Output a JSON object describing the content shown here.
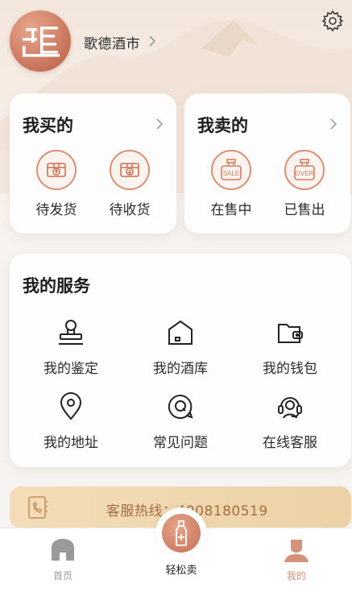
{
  "header": {
    "shop_name": "歌德酒市",
    "avatar_icon": "logo-avatar",
    "settings_icon": "gear-icon"
  },
  "buy_card": {
    "title": "我买的",
    "items": [
      {
        "label": "待发货",
        "icon": "package-up-icon"
      },
      {
        "label": "待收货",
        "icon": "package-down-icon"
      }
    ]
  },
  "sell_card": {
    "title": "我卖的",
    "items": [
      {
        "label": "在售中",
        "icon": "sale-bag-icon",
        "badge": "SALE"
      },
      {
        "label": "已售出",
        "icon": "over-bag-icon",
        "badge": "OVER"
      }
    ]
  },
  "services": {
    "title": "我的服务",
    "items": [
      {
        "label": "我的鉴定",
        "icon": "stamp-icon"
      },
      {
        "label": "我的酒库",
        "icon": "cellar-icon"
      },
      {
        "label": "我的钱包",
        "icon": "wallet-icon"
      },
      {
        "label": "我的地址",
        "icon": "location-icon"
      },
      {
        "label": "常见问题",
        "icon": "question-icon"
      },
      {
        "label": "在线客服",
        "icon": "headset-icon"
      }
    ]
  },
  "hotline": {
    "text": "客服热线：4008180519"
  },
  "tabbar": {
    "home": "首页",
    "sell": "轻松卖",
    "me": "我的"
  },
  "colors": {
    "accent": "#c9765b",
    "gold_text": "#a66c43",
    "tab_active": "#d4927a",
    "tab_inactive": "#9a9a9a"
  }
}
